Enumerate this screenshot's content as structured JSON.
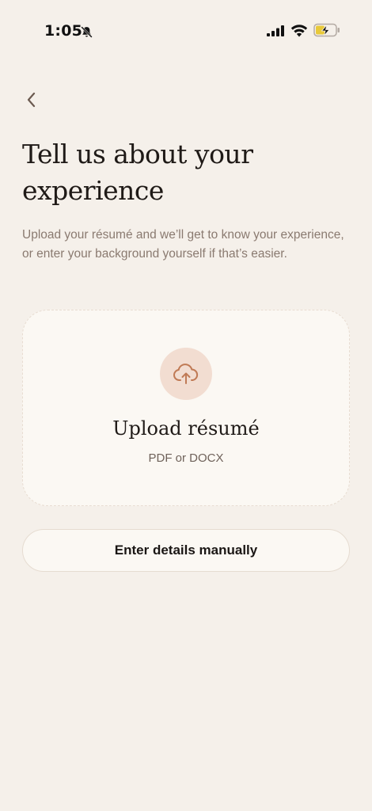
{
  "status_bar": {
    "time": "1:05",
    "icons": [
      "bell-off-icon",
      "signal-icon",
      "wifi-icon",
      "battery-charging-icon"
    ]
  },
  "nav": {
    "back_icon": "chevron-left-icon"
  },
  "header": {
    "title": "Tell us about your experience",
    "subtitle": "Upload your résumé and we’ll get to know your experience, or enter your background yourself if that’s easier."
  },
  "upload": {
    "icon": "cloud-upload-icon",
    "title": "Upload résumé",
    "formats": "PDF or DOCX"
  },
  "manual": {
    "label": "Enter details manually"
  },
  "colors": {
    "background": "#f5f0ea",
    "card": "#fbf8f3",
    "accent": "#c07a55",
    "accent_bg": "#f2ddd1",
    "muted_text": "#8a7a70"
  }
}
